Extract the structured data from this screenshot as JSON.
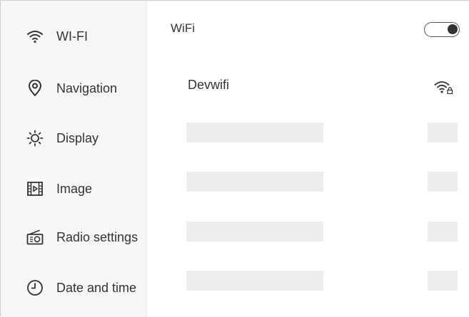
{
  "sidebar": {
    "items": [
      {
        "label": "WI-FI",
        "icon": "wifi-icon"
      },
      {
        "label": "Navigation",
        "icon": "location-pin-icon"
      },
      {
        "label": "Display",
        "icon": "brightness-icon"
      },
      {
        "label": "Image",
        "icon": "film-icon"
      },
      {
        "label": "Radio settings",
        "icon": "radio-icon"
      },
      {
        "label": "Date and time",
        "icon": "clock-icon"
      }
    ]
  },
  "wifi": {
    "title": "WiFi",
    "toggle_on": true,
    "networks": [
      {
        "name": "Devwifi",
        "icon": "wifi-lock-icon"
      }
    ],
    "placeholder_rows": 4
  }
}
